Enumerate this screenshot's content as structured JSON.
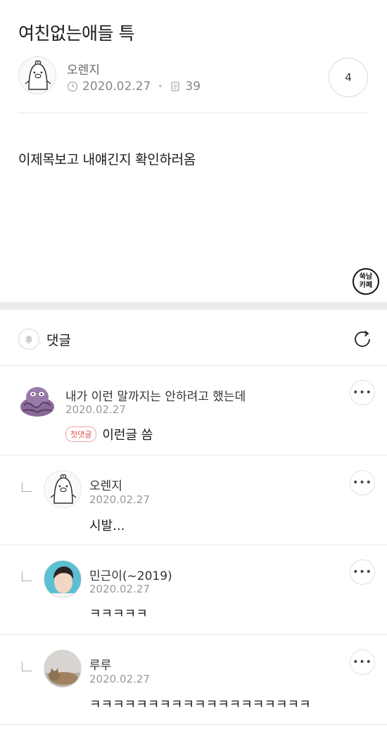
{
  "post": {
    "title": "여친없는애들 특",
    "author": "오렌지",
    "date": "2020.02.27",
    "views": "39",
    "comment_count": "4",
    "body": "이제목보고 내얘긴지 확인하러옴",
    "stamp_line1": "쑥남",
    "stamp_line2": "카페"
  },
  "comments_section": {
    "label": "댓글"
  },
  "comments": [
    {
      "author": "내가 이런 말까지는 안하려고 했는데",
      "date": "2020.02.27",
      "badge": "첫댓글",
      "text": "이런글 씀"
    },
    {
      "author": "오렌지",
      "date": "2020.02.27",
      "text": "시발..."
    },
    {
      "author": "민근이(~2019)",
      "date": "2020.02.27",
      "text": "ㅋㅋㅋㅋㅋ"
    },
    {
      "author": "루루",
      "date": "2020.02.27",
      "text": "ㅋㅋㅋㅋㅋㅋㅋㅋㅋㅋㅋㅋㅋㅋㅋㅋㅋㅋㅋ"
    }
  ],
  "icons": {
    "clock": "clock-icon",
    "views": "document-icon",
    "bell": "bell-icon",
    "refresh": "refresh-icon",
    "more": "more-icon"
  },
  "colors": {
    "first_badge": "#e24d4d",
    "section_gap": "#ebebeb"
  }
}
